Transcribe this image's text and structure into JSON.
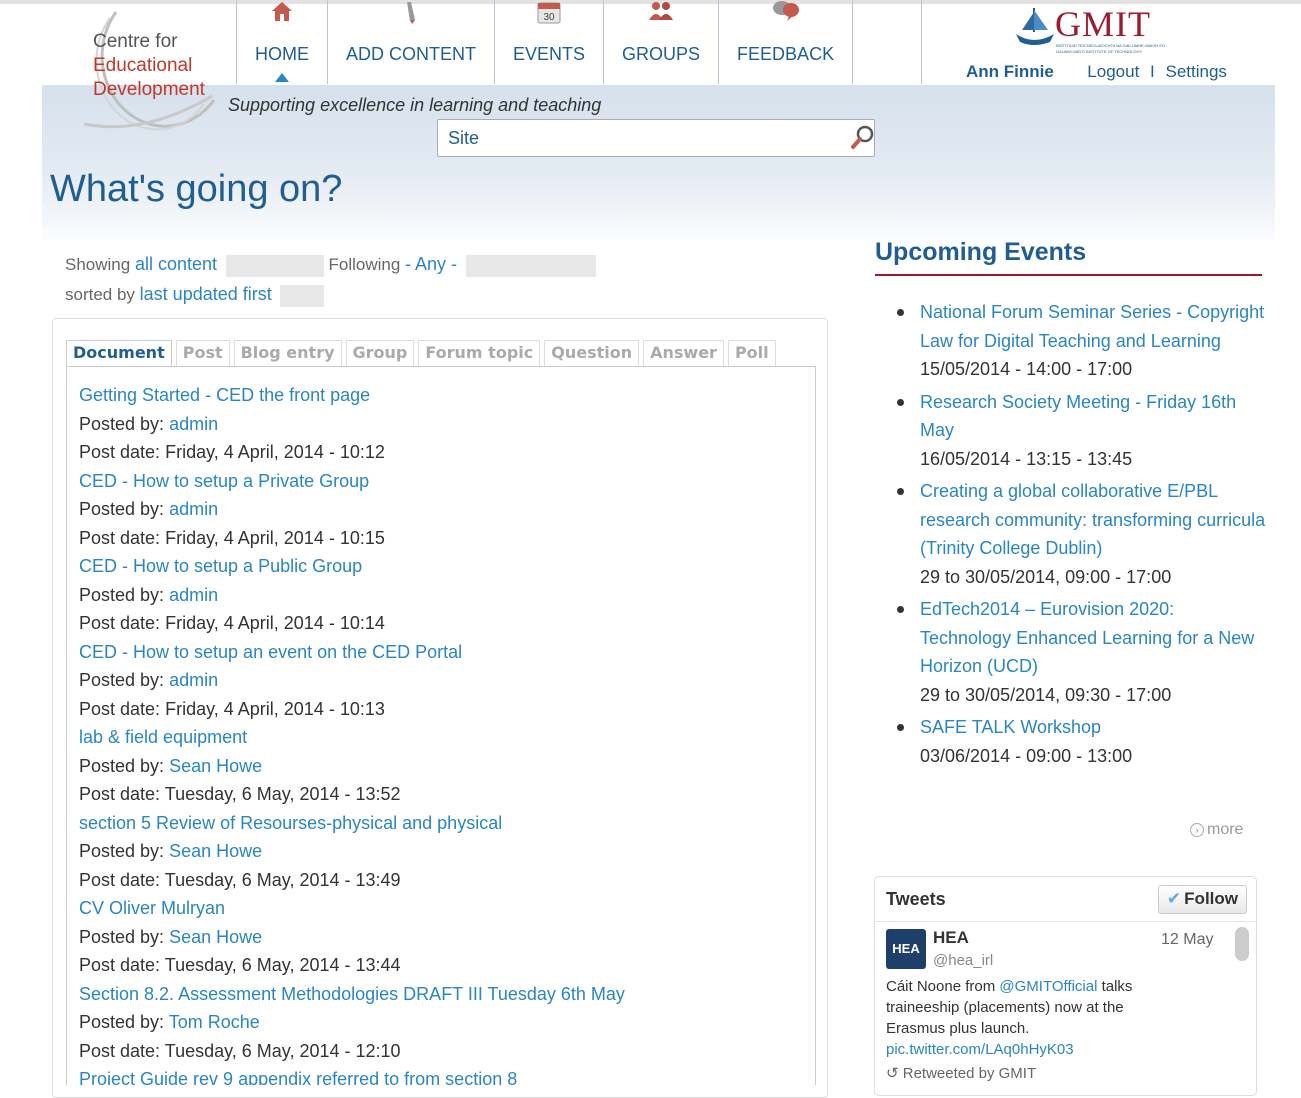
{
  "logo": {
    "line1": "Centre for",
    "line2": "Educational",
    "line3": "Development"
  },
  "nav": [
    {
      "label": "HOME",
      "icon": "home-icon",
      "active": true
    },
    {
      "label": "ADD CONTENT",
      "icon": "pencil-icon",
      "active": false
    },
    {
      "label": "EVENTS",
      "icon": "calendar-icon",
      "active": false
    },
    {
      "label": "GROUPS",
      "icon": "people-icon",
      "active": false
    },
    {
      "label": "FEEDBACK",
      "icon": "speech-bubbles-icon",
      "active": false
    }
  ],
  "calendar_day": "30",
  "gmit": {
    "word": "GMIT",
    "sub1": "INSTITIÚID TEICNEOLAÍOCHTA NA GAILLIMHE-MAIGH EO",
    "sub2": "GALWAY-MAYO INSTITUTE OF TECHNOLOGY"
  },
  "user": {
    "name": "Ann Finnie",
    "logout": "Logout",
    "separator": "I",
    "settings": "Settings"
  },
  "tagline": "Supporting excellence in learning and teaching",
  "search": {
    "value": "Site"
  },
  "page_title": "What's going on?",
  "filters": {
    "showing_label": "Showing",
    "showing_value": "all content",
    "following_label": "Following",
    "following_value": "- Any -",
    "sorted_label": "sorted by",
    "sorted_value": "last updated first"
  },
  "tabs": [
    "Document",
    "Post",
    "Blog entry",
    "Group",
    "Forum topic",
    "Question",
    "Answer",
    "Poll"
  ],
  "posted_by_label": "Posted by:",
  "post_date_label": "Post date:",
  "documents": [
    {
      "title": "Getting Started - CED the front page",
      "author": "admin",
      "date": "Friday, 4 April, 2014 - 10:12"
    },
    {
      "title": "CED - How to setup a Private Group",
      "author": "admin",
      "date": "Friday, 4 April, 2014 - 10:15"
    },
    {
      "title": "CED - How to setup a Public Group",
      "author": "admin",
      "date": "Friday, 4 April, 2014 - 10:14"
    },
    {
      "title": "CED - How to setup an event on the CED Portal",
      "author": "admin",
      "date": "Friday, 4 April, 2014 - 10:13"
    },
    {
      "title": "lab & field equipment",
      "author": "Sean Howe",
      "date": "Tuesday, 6 May, 2014 - 13:52"
    },
    {
      "title": "section 5 Review of Resourses-physical and physical",
      "author": "Sean Howe",
      "date": "Tuesday, 6 May, 2014 - 13:49"
    },
    {
      "title": "CV Oliver Mulryan",
      "author": "Sean Howe",
      "date": "Tuesday, 6 May, 2014 - 13:44"
    },
    {
      "title": "Section 8.2. Assessment Methodologies DRAFT III Tuesday 6th May",
      "author": "Tom Roche",
      "date": "Tuesday, 6 May, 2014 - 12:10"
    },
    {
      "title": "Project Guide rev 9 appendix referred to from section 8",
      "author": "",
      "date": ""
    }
  ],
  "sidebar": {
    "title": "Upcoming Events",
    "more": "more",
    "events": [
      {
        "title": "National Forum Seminar Series - Copyright Law for Digital Teaching and Learning",
        "date": "15/05/2014 - 14:00 - 17:00"
      },
      {
        "title": "Research Society Meeting - Friday 16th May",
        "date": "16/05/2014 - 13:15 - 13:45"
      },
      {
        "title": "Creating a global collaborative E/PBL research community: transforming curricula (Trinity College Dublin)",
        "date": "29 to 30/05/2014, 09:00 - 17:00"
      },
      {
        "title": "EdTech2014 – Eurovision 2020: Technology Enhanced Learning for a New Horizon (UCD)",
        "date": "29 to 30/05/2014, 09:30 - 17:00"
      },
      {
        "title": "SAFE TALK Workshop",
        "date": "03/06/2014 - 09:00 - 13:00"
      }
    ]
  },
  "tweets": {
    "header": "Tweets",
    "follow": "Follow",
    "avatar_text": "HEA",
    "name": "HEA",
    "handle": "@hea_irl",
    "date": "12 May",
    "text_before": "Cáit Noone from ",
    "mention": "@GMITOfficial",
    "text_after": " talks traineeship (placements) now at the Erasmus plus launch.",
    "link": "pic.twitter.com/LAq0hHyK03",
    "retweet": "Retweeted by GMIT"
  },
  "colors": {
    "nav_text": "#1f5d92",
    "link": "#2a86c2",
    "accent_red": "#9b1b30",
    "band": "#d6e1ed"
  }
}
